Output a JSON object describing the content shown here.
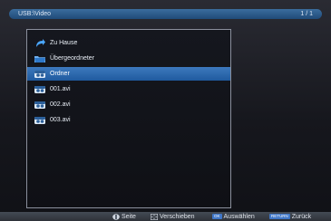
{
  "header": {
    "path": "USB:\\Video",
    "page": "1 / 1"
  },
  "list": {
    "items": [
      {
        "label": "Zu Hause",
        "icon": "home-arrow-icon"
      },
      {
        "label": "Übergeordneter",
        "icon": "parent-folder-icon"
      },
      {
        "label": "Ordner",
        "icon": "video-file-icon",
        "selected": true
      },
      {
        "label": "001.avi",
        "icon": "video-file-icon"
      },
      {
        "label": "002.avi",
        "icon": "video-file-icon"
      },
      {
        "label": "003.avi",
        "icon": "video-file-icon"
      }
    ]
  },
  "footer": {
    "page_label": "Seite",
    "move_label": "Verschieben",
    "ok_key": "OK",
    "select_label": "Auswählen",
    "return_key": "RETURN",
    "back_label": "Zurück"
  },
  "colors": {
    "accent": "#2a68ad",
    "title_bar": "#2f5e8f",
    "footer": "#3a3f47"
  }
}
